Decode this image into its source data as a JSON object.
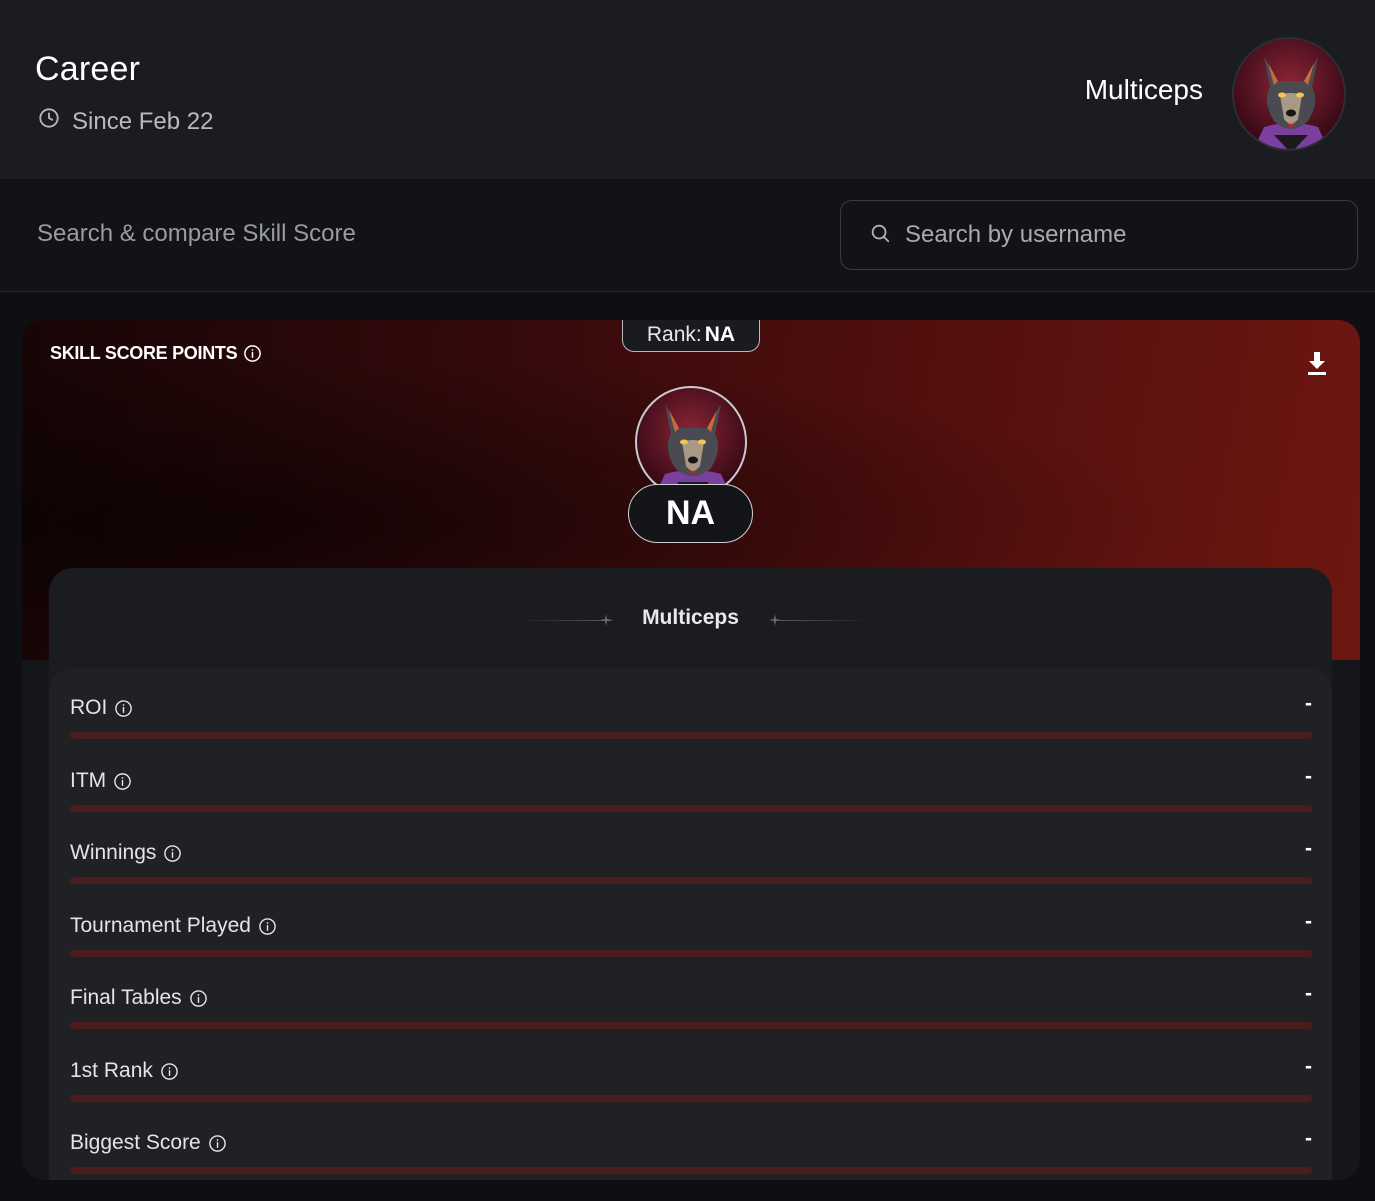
{
  "header": {
    "title": "Career",
    "since": "Since Feb 22",
    "username": "Multiceps"
  },
  "search": {
    "label": "Search & compare Skill Score",
    "placeholder": "Search by username"
  },
  "card": {
    "title": "SKILL SCORE POINTS",
    "rank_prefix": "Rank:",
    "rank_value": "NA",
    "score": "NA",
    "player_name": "Multiceps",
    "stats": [
      {
        "label": "ROI",
        "value": "-",
        "progress": 0
      },
      {
        "label": "ITM",
        "value": "-",
        "progress": 0
      },
      {
        "label": "Winnings",
        "value": "-",
        "progress": 0
      },
      {
        "label": "Tournament Played",
        "value": "-",
        "progress": 0
      },
      {
        "label": "Final Tables",
        "value": "-",
        "progress": 0
      },
      {
        "label": "1st Rank",
        "value": "-",
        "progress": 0
      },
      {
        "label": "Biggest Score",
        "value": "-",
        "progress": 0
      }
    ]
  },
  "icons": {
    "clock": "clock-icon",
    "search": "search-icon",
    "info": "info-icon",
    "download": "download-icon",
    "avatar": "wolf-avatar"
  },
  "colors": {
    "accent_red": "#6e1711",
    "bar_track": "#4b1c1e",
    "background": "#0e0f12"
  }
}
